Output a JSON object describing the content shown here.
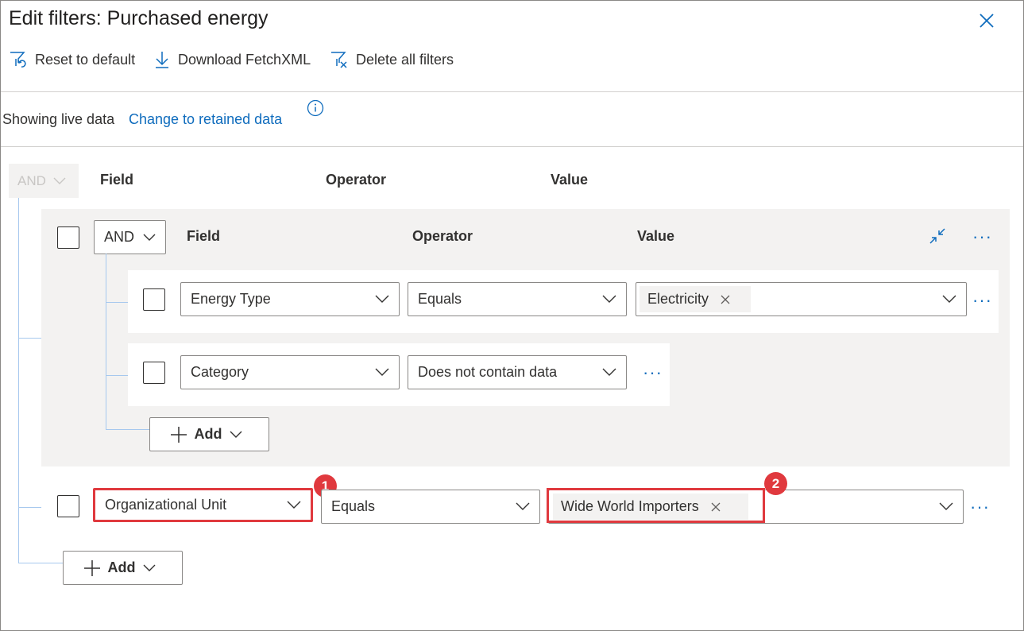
{
  "dialog": {
    "title": "Edit filters: Purchased energy"
  },
  "toolbar": {
    "reset_label": "Reset to default",
    "download_label": "Download FetchXML",
    "delete_label": "Delete all filters"
  },
  "data_source": {
    "status_text": "Showing live data",
    "change_link": "Change to retained data"
  },
  "root": {
    "operator": "AND",
    "headers": {
      "field": "Field",
      "operator": "Operator",
      "value": "Value"
    },
    "add_label": "Add"
  },
  "group": {
    "operator": "AND",
    "headers": {
      "field": "Field",
      "operator": "Operator",
      "value": "Value"
    },
    "add_label": "Add",
    "rows": [
      {
        "field": "Energy Type",
        "operator": "Equals",
        "value_tag": "Electricity"
      },
      {
        "field": "Category",
        "operator": "Does not contain data"
      }
    ]
  },
  "bottom_row": {
    "field": "Organizational Unit",
    "operator": "Equals",
    "value_tag": "Wide World Importers"
  },
  "callouts": {
    "first": "1",
    "second": "2"
  },
  "colors": {
    "accent": "#0f6cbd",
    "callout": "#e0393e",
    "tree_line": "#a6c8ee"
  }
}
